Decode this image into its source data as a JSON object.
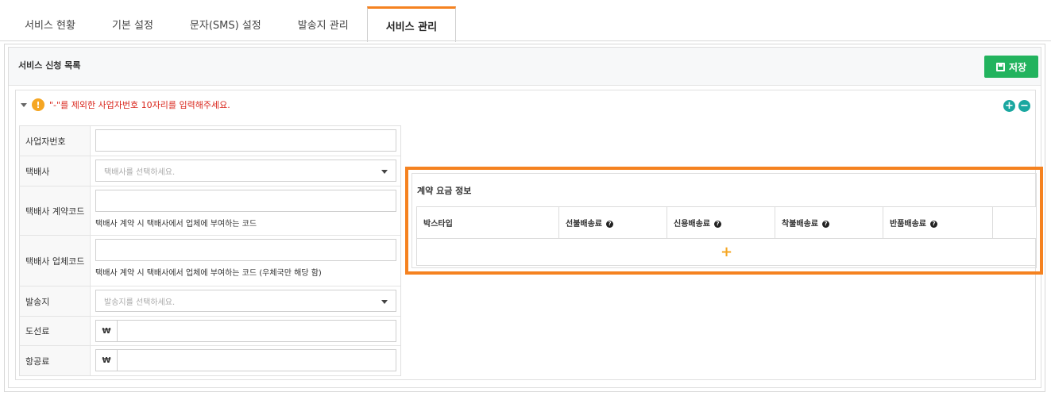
{
  "tabs": [
    {
      "label": "서비스 현황"
    },
    {
      "label": "기본 설정"
    },
    {
      "label": "문자(SMS) 설정"
    },
    {
      "label": "발송지 관리"
    },
    {
      "label": "서비스 관리"
    }
  ],
  "active_tab": "서비스 관리",
  "panel": {
    "title": "서비스 신청 목록",
    "save_label": "저장"
  },
  "notice": {
    "icon": "!",
    "text": "\"-\"를 제외한 사업자번호 10자리를 입력해주세요."
  },
  "round_buttons": {
    "add": "+",
    "remove": "−"
  },
  "form": {
    "business_no": {
      "label": "사업자번호",
      "value": ""
    },
    "courier": {
      "label": "택배사",
      "placeholder": "택배사를 선택하세요."
    },
    "contract_code": {
      "label": "택배사 계약코드",
      "help": "택배사 계약 시 택배사에서 업체에 부여하는 코드",
      "value": ""
    },
    "company_code": {
      "label": "택배사 업체코드",
      "help": "택배사 계약 시 택배사에서 업체에 부여하는 코드 (우체국만 해당 함)",
      "value": ""
    },
    "origin": {
      "label": "발송지",
      "placeholder": "발송지를 선택하세요."
    },
    "island_fee": {
      "label": "도선료",
      "currency": "₩",
      "value": ""
    },
    "air_fee": {
      "label": "항공료",
      "currency": "₩",
      "value": ""
    }
  },
  "contract": {
    "title": "계약 요금 정보",
    "columns": [
      "박스타입",
      "선불배송료",
      "신용배송료",
      "착불배송료",
      "반품배송료"
    ],
    "help_icon": "?",
    "add_symbol": "+"
  },
  "colors": {
    "accent": "#f58220",
    "save": "#22b35e",
    "round": "#1aa7a0",
    "warn": "#f5a623",
    "notice": "#d9261c"
  }
}
